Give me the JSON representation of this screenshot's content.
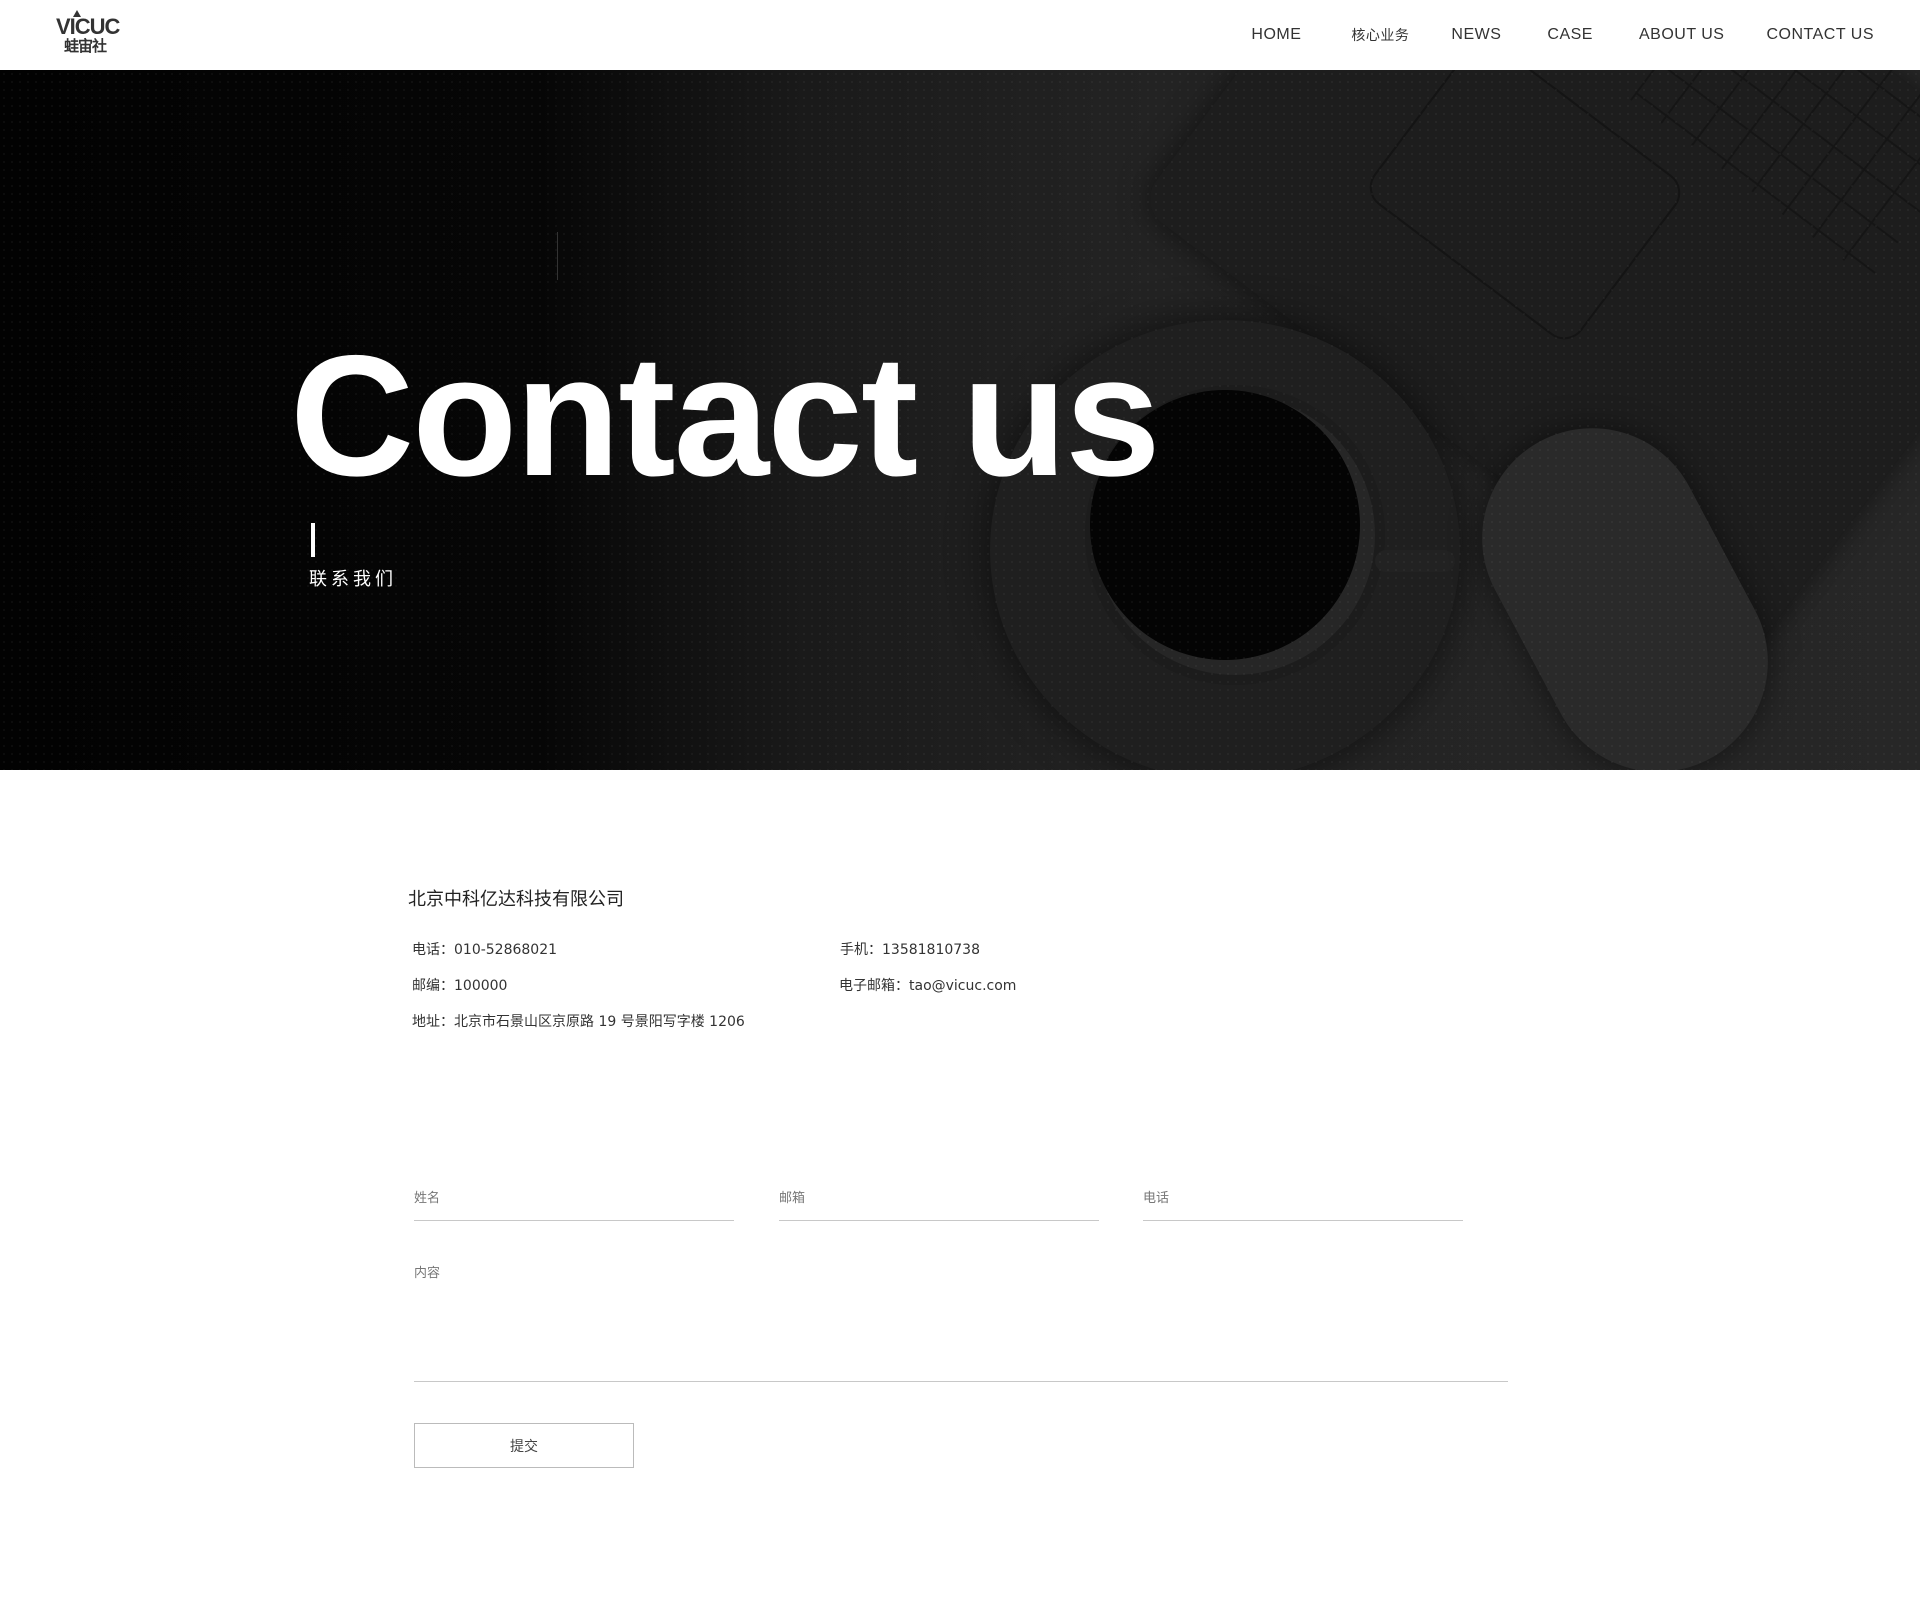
{
  "header": {
    "logo_top": "VICUC",
    "logo_bottom": "蛙宙社",
    "nav": [
      {
        "label": "HOME"
      },
      {
        "label": "核心业务"
      },
      {
        "label": "NEWS"
      },
      {
        "label": "CASE"
      },
      {
        "label": "ABOUT US"
      },
      {
        "label": "CONTACT US"
      }
    ]
  },
  "hero": {
    "title": "Contact us",
    "subtitle": "联系我们"
  },
  "contact": {
    "company": "北京中科亿达科技有限公司",
    "phone": "电话：010-52868021",
    "mobile": "手机：13581810738",
    "postcode": "邮编：100000",
    "email": "电子邮箱：tao@vicuc.com",
    "address": "地址：北京市石景山区京原路 19 号景阳写字楼 1206"
  },
  "form": {
    "name_placeholder": "姓名",
    "email_placeholder": "邮箱",
    "phone_placeholder": "电话",
    "content_placeholder": "内容",
    "submit_label": "提交"
  }
}
